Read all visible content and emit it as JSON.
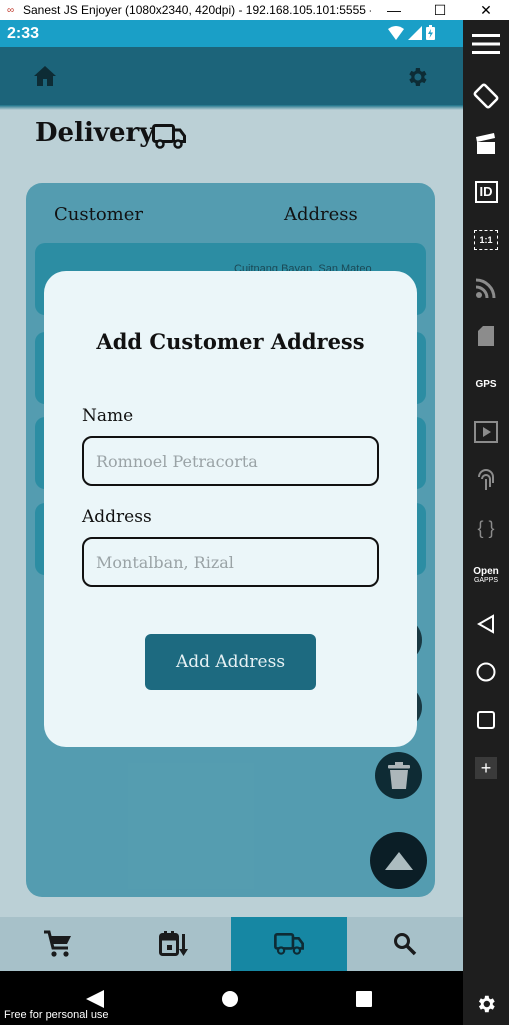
{
  "window": {
    "title": "Sanest JS Enjoyer (1080x2340, 420dpi) - 192.168.105.101:5555 -...",
    "minimize": "—",
    "maximize": "☐",
    "close": "✕"
  },
  "status_bar": {
    "time": "2:33"
  },
  "page": {
    "title": "Delivery"
  },
  "list": {
    "headers": [
      "Customer",
      "Address"
    ],
    "partial_row_text": "Cuitnang Bayan, San Mateo"
  },
  "modal": {
    "title": "Add Customer Address",
    "name_label": "Name",
    "name_placeholder": "Romnoel Petracorta",
    "name_value": "",
    "address_label": "Address",
    "address_placeholder": "Montalban, Rizal",
    "address_value": "",
    "submit_label": "Add Address"
  },
  "bottom_nav": {
    "items": [
      "cart-icon",
      "calendar-sort-icon",
      "truck-icon",
      "search-icon"
    ],
    "active": "truck-icon"
  },
  "emulator_toolbar": {
    "id_label": "ID",
    "ratio_label": "1:1",
    "gps_label": "GPS",
    "braces_label": "{ }",
    "open_label": "Open",
    "gapps_label": "GAPPS",
    "plus_label": "+"
  },
  "watermark": "Free for personal use",
  "colors": {
    "status_bar": "#1a9fc7",
    "app_bar": "#1d6a80",
    "modal_bg": "#ebf6f9",
    "button": "#1d6a80",
    "nav_active": "#1690ad"
  }
}
